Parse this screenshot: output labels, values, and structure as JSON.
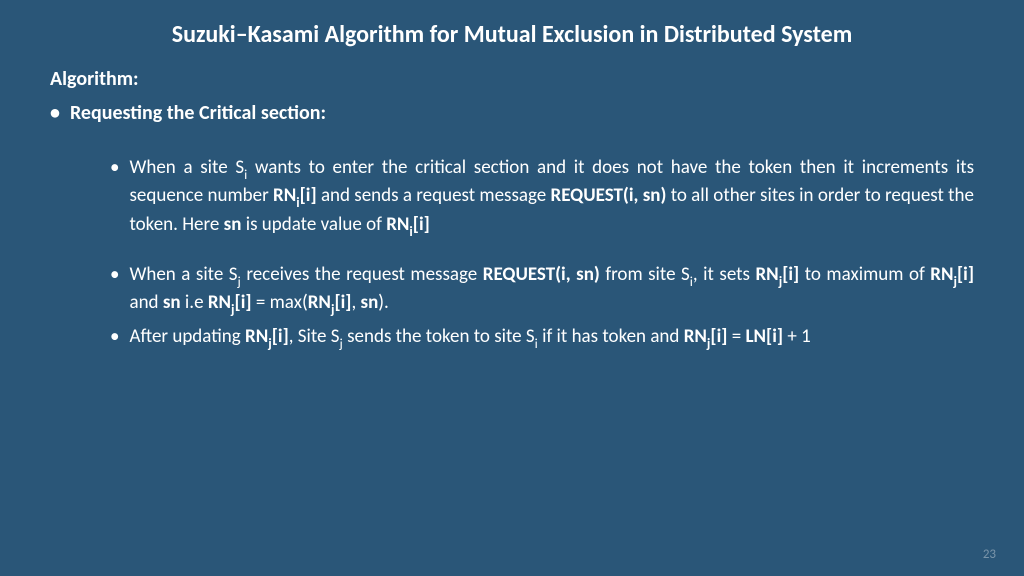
{
  "title": "Suzuki–Kasami Algorithm for Mutual Exclusion in Distributed System",
  "heading": "Algorithm:",
  "bullet1": "Requesting the Critical section:",
  "p1": {
    "t1": "When a site S",
    "sub1": "i",
    "t2": " wants to enter the critical section and it does not have the token then it increments its sequence number ",
    "b1": "RN",
    "sub2": "i",
    "b2": "[i]",
    "t3": " and sends a request message ",
    "b3": "REQUEST(i, sn)",
    "t4": " to all other sites in order to request the token. Here ",
    "b4": "sn",
    "t5": " is update value of ",
    "b5": "RN",
    "sub3": "i",
    "b6": "[i]"
  },
  "p2": {
    "t1": "When a site S",
    "sub1": "j",
    "t2": " receives the request message ",
    "b1": "REQUEST(i, sn)",
    "t3": " from site S",
    "sub2": "i",
    "t4": ", it sets ",
    "b2": "RN",
    "sub3": "j",
    "b3": "[i]",
    "t5": " to maximum of ",
    "b4": "RN",
    "sub4": "j",
    "b5": "[i]",
    "t6": " and ",
    "b6": "sn",
    "t7": " i.e ",
    "b7": "RN",
    "sub5": "j",
    "b8": "[i]",
    "t8": " = max(",
    "b9": "RN",
    "sub6": "j",
    "b10": "[i]",
    "t9": ", ",
    "b11": "sn",
    "t10": ")."
  },
  "p3": {
    "t1": "After updating ",
    "b1": "RN",
    "sub1": "j",
    "b2": "[i]",
    "t2": ", Site S",
    "sub2": "j",
    "t3": " sends the token to site S",
    "sub3": "i",
    "t4": " if it has token and ",
    "b3": "RN",
    "sub4": "j",
    "b4": "[i]",
    "t5": " = ",
    "b5": "LN[i]",
    "t6": " + 1"
  },
  "pageNumber": "23"
}
